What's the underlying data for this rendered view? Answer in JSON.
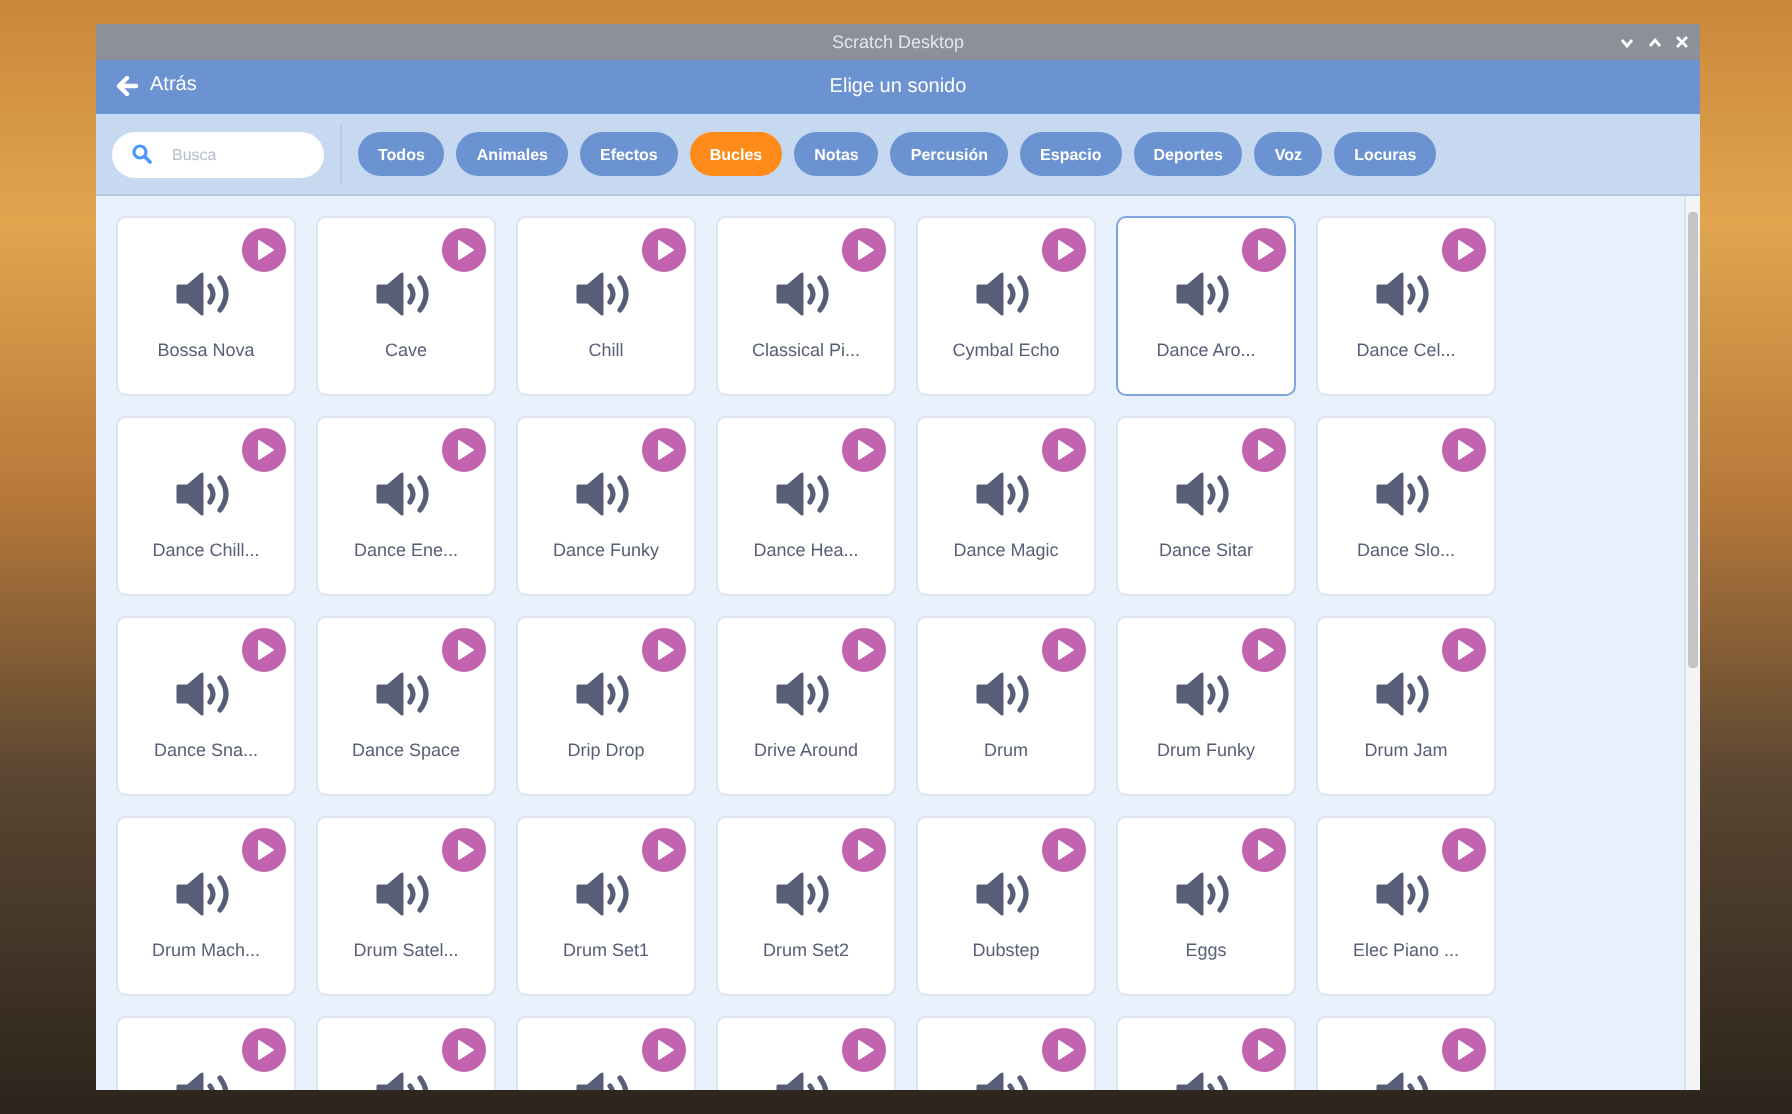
{
  "window": {
    "title": "Scratch Desktop"
  },
  "header": {
    "back_label": "Atrás",
    "title": "Elige un sonido"
  },
  "search": {
    "placeholder": "Busca"
  },
  "tags": [
    {
      "label": "Todos",
      "selected": false
    },
    {
      "label": "Animales",
      "selected": false
    },
    {
      "label": "Efectos",
      "selected": false
    },
    {
      "label": "Bucles",
      "selected": true
    },
    {
      "label": "Notas",
      "selected": false
    },
    {
      "label": "Percusión",
      "selected": false
    },
    {
      "label": "Espacio",
      "selected": false
    },
    {
      "label": "Deportes",
      "selected": false
    },
    {
      "label": "Voz",
      "selected": false
    },
    {
      "label": "Locuras",
      "selected": false
    }
  ],
  "sounds": [
    {
      "name": "Bossa Nova",
      "selected": false
    },
    {
      "name": "Cave",
      "selected": false
    },
    {
      "name": "Chill",
      "selected": false
    },
    {
      "name": "Classical Pi...",
      "selected": false
    },
    {
      "name": "Cymbal Echo",
      "selected": false
    },
    {
      "name": "Dance Aro...",
      "selected": true
    },
    {
      "name": "Dance Cel...",
      "selected": false
    },
    {
      "name": "Dance Chill...",
      "selected": false
    },
    {
      "name": "Dance Ene...",
      "selected": false
    },
    {
      "name": "Dance Funky",
      "selected": false
    },
    {
      "name": "Dance Hea...",
      "selected": false
    },
    {
      "name": "Dance Magic",
      "selected": false
    },
    {
      "name": "Dance Sitar",
      "selected": false
    },
    {
      "name": "Dance Slo...",
      "selected": false
    },
    {
      "name": "Dance Sna...",
      "selected": false
    },
    {
      "name": "Dance Space",
      "selected": false
    },
    {
      "name": "Drip Drop",
      "selected": false
    },
    {
      "name": "Drive Around",
      "selected": false
    },
    {
      "name": "Drum",
      "selected": false
    },
    {
      "name": "Drum Funky",
      "selected": false
    },
    {
      "name": "Drum Jam",
      "selected": false
    },
    {
      "name": "Drum Mach...",
      "selected": false
    },
    {
      "name": "Drum Satel...",
      "selected": false
    },
    {
      "name": "Drum Set1",
      "selected": false
    },
    {
      "name": "Drum Set2",
      "selected": false
    },
    {
      "name": "Dubstep",
      "selected": false
    },
    {
      "name": "Eggs",
      "selected": false
    },
    {
      "name": "Elec Piano ...",
      "selected": false
    },
    {
      "selected": false
    },
    {
      "selected": false
    },
    {
      "selected": false
    },
    {
      "selected": false
    },
    {
      "selected": false
    },
    {
      "selected": false
    },
    {
      "selected": false
    }
  ]
}
